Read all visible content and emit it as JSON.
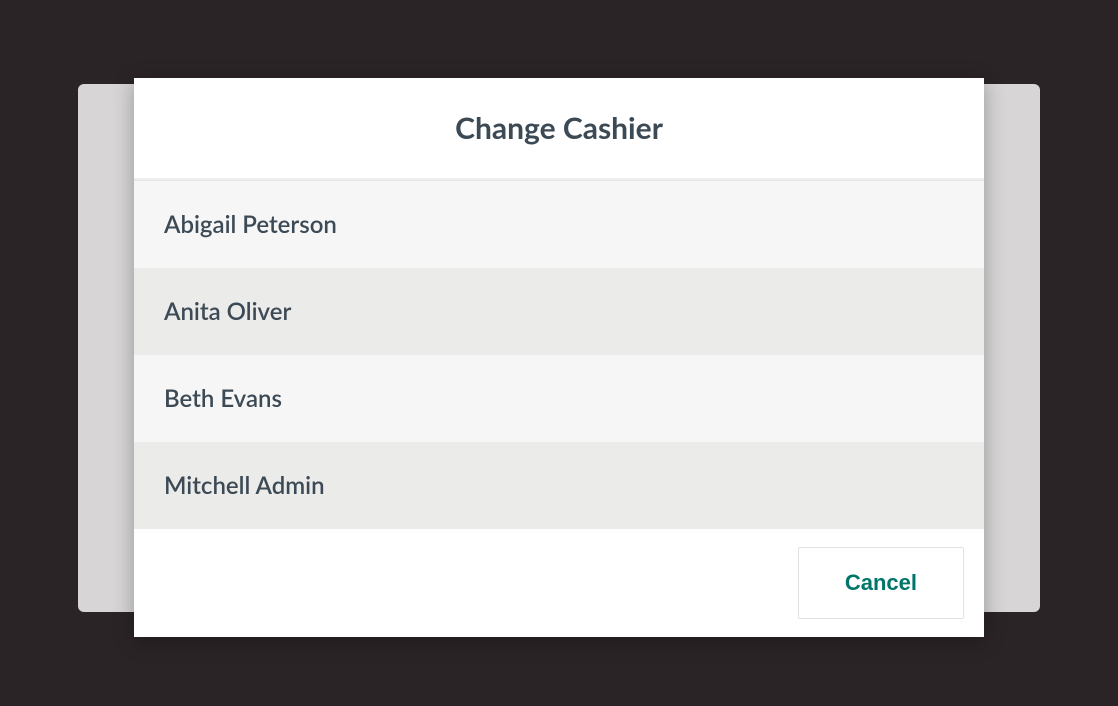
{
  "modal": {
    "title": "Change Cashier",
    "cashiers": [
      "Abigail Peterson",
      "Anita Oliver",
      "Beth Evans",
      "Mitchell Admin"
    ],
    "cancel_label": "Cancel"
  }
}
